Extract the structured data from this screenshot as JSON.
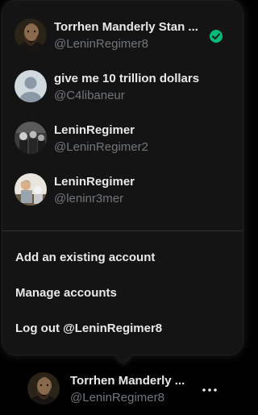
{
  "account_menu": {
    "accounts": [
      {
        "name": "Torrhen Manderly Stan ...",
        "handle": "@LeninRegimer8",
        "current": true,
        "avatar": "bearded-man-photo"
      },
      {
        "name": "give me 10 trillion dollars",
        "handle": "@C4libaneur",
        "current": false,
        "avatar": "default-profile-placeholder"
      },
      {
        "name": "LeninRegimer",
        "handle": "@LeninRegimer2",
        "current": false,
        "avatar": "group-photo-bw"
      },
      {
        "name": "LeninRegimer",
        "handle": "@leninr3mer",
        "current": false,
        "avatar": "figure-photo"
      }
    ],
    "actions": {
      "add_existing": "Add an existing account",
      "manage": "Manage accounts",
      "logout": "Log out @LeninRegimer8"
    }
  },
  "current_account": {
    "name": "Torrhen Manderly ...",
    "handle": "@LeninRegimer8",
    "avatar": "bearded-man-photo"
  },
  "colors": {
    "background": "#000000",
    "menu_bg": "#141414",
    "text_primary": "#e7e9ea",
    "text_secondary": "#71767b",
    "check_green": "#00ba7c",
    "divider": "#2f3336"
  },
  "icons": {
    "current_indicator": "check-circle-icon",
    "more": "more-horizontal-icon"
  }
}
